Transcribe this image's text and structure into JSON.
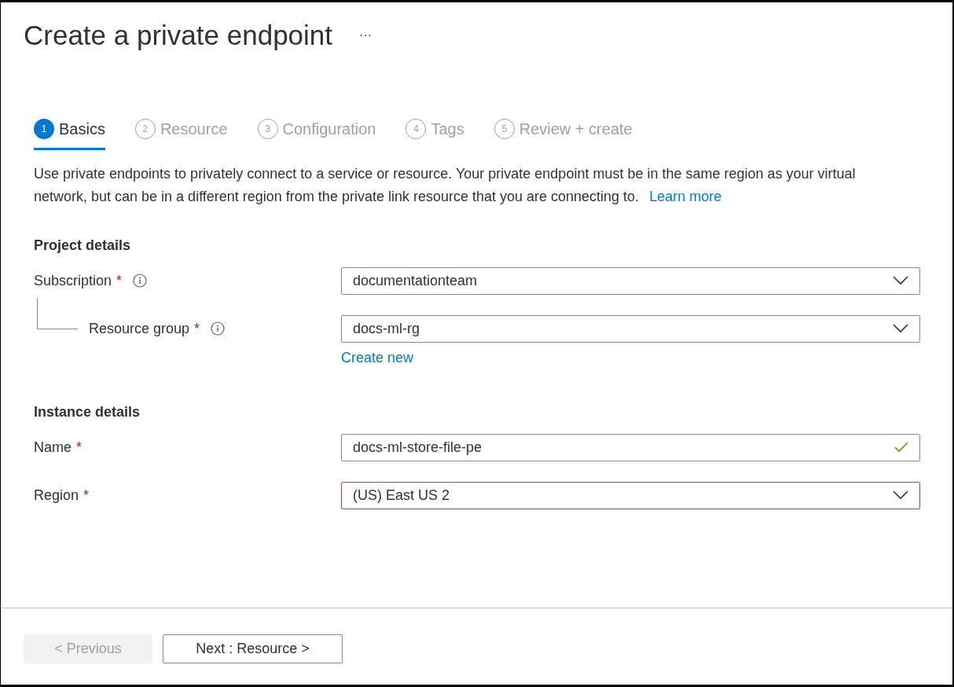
{
  "title": "Create a private endpoint",
  "more_menu": "···",
  "tabs": [
    {
      "number": "1",
      "label": "Basics",
      "selected": true
    },
    {
      "number": "2",
      "label": "Resource",
      "selected": false
    },
    {
      "number": "3",
      "label": "Configuration",
      "selected": false
    },
    {
      "number": "4",
      "label": "Tags",
      "selected": false
    },
    {
      "number": "5",
      "label": "Review + create",
      "selected": false
    }
  ],
  "description": {
    "text": "Use private endpoints to privately connect to a service or resource. Your private endpoint must be in the same region as your virtual network, but can be in a different region from the private link resource that you are connecting to.",
    "link": "Learn more"
  },
  "sections": [
    {
      "heading": "Project details",
      "fields": [
        {
          "label": "Subscription",
          "required": "*",
          "info": true,
          "nested": false,
          "kind": "dropdown",
          "value": "documentationteam",
          "valid": false,
          "focused": false
        },
        {
          "label": "Resource group",
          "required": "*",
          "info": true,
          "nested": true,
          "kind": "dropdown",
          "value": "docs-ml-rg",
          "valid": false,
          "focused": false,
          "link": "Create new"
        }
      ]
    },
    {
      "heading": "Instance details",
      "fields": [
        {
          "label": "Name",
          "required": "*",
          "info": false,
          "nested": false,
          "kind": "text",
          "value": "docs-ml-store-file-pe",
          "valid": true,
          "focused": false
        },
        {
          "label": "Region",
          "required": "*",
          "info": false,
          "nested": false,
          "kind": "dropdown",
          "value": "(US) East US 2",
          "valid": false,
          "focused": true
        }
      ]
    }
  ],
  "buttons": [
    {
      "label": "< Previous",
      "disabled": true
    },
    {
      "label": "Next : Resource >",
      "disabled": false
    }
  ]
}
